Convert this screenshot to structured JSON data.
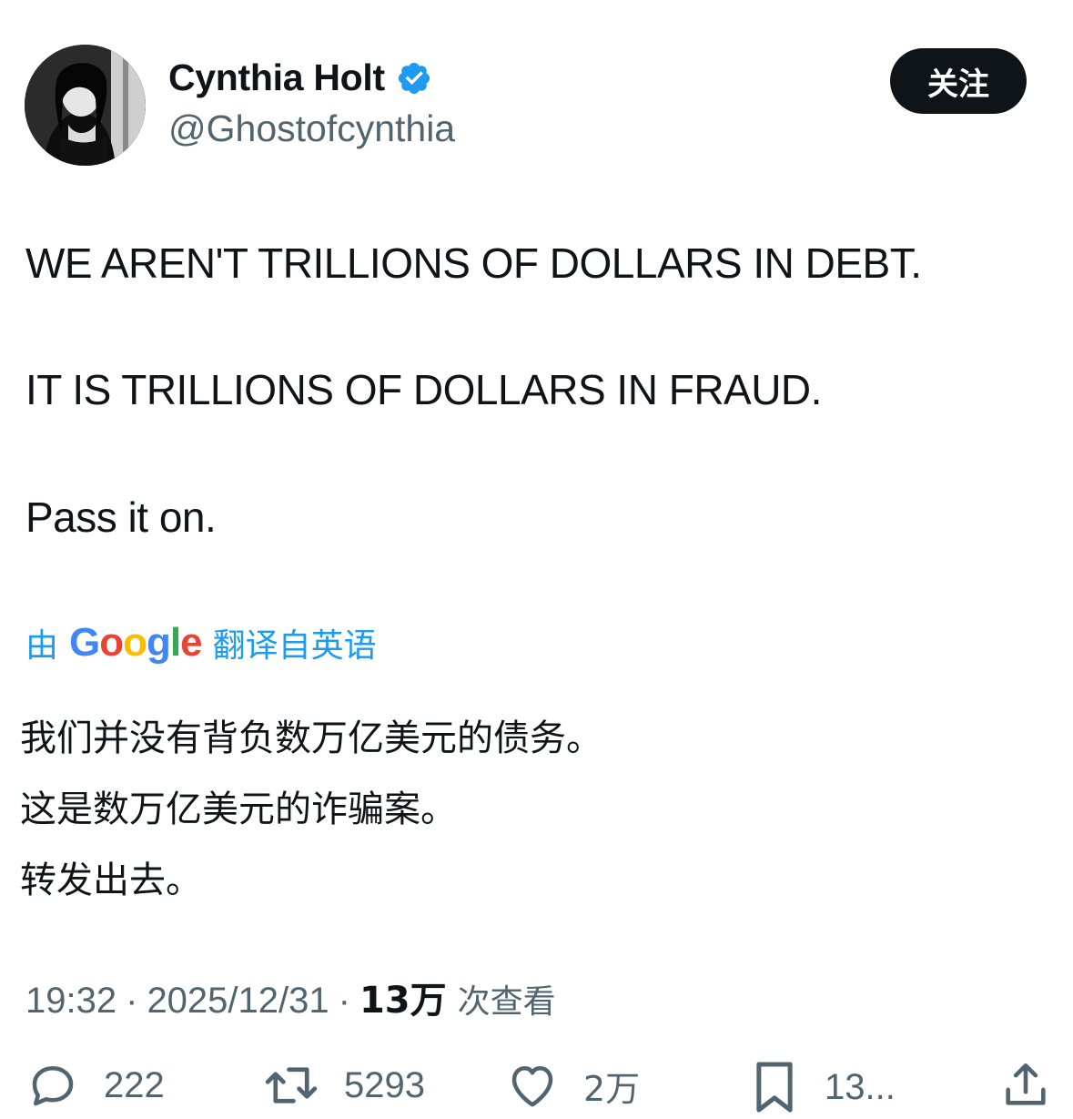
{
  "author": {
    "name": "Cynthia Holt",
    "handle": "@Ghostofcynthia",
    "verified": true,
    "verified_color": "#1d9bf0"
  },
  "follow_button": {
    "label": "关注"
  },
  "tweet": {
    "lines": [
      "WE AREN'T TRILLIONS OF DOLLARS IN DEBT.",
      "IT IS TRILLIONS OF DOLLARS IN FRAUD.",
      "Pass it on."
    ]
  },
  "translation": {
    "prefix": "由",
    "provider": "Google",
    "suffix": "翻译自英语",
    "lines": [
      "我们并没有背负数万亿美元的债务。",
      "这是数万亿美元的诈骗案。",
      "转发出去。"
    ]
  },
  "meta": {
    "time": "19:32",
    "separator": "·",
    "date": "2025/12/31",
    "views": "13万",
    "views_label": "次查看"
  },
  "actions": {
    "reply": {
      "icon": "reply-icon",
      "count": "222"
    },
    "retweet": {
      "icon": "retweet-icon",
      "count": "5293"
    },
    "like": {
      "icon": "heart-icon",
      "count": "2万"
    },
    "bookmark": {
      "icon": "bookmark-icon",
      "count": "13..."
    },
    "share": {
      "icon": "share-icon"
    }
  }
}
